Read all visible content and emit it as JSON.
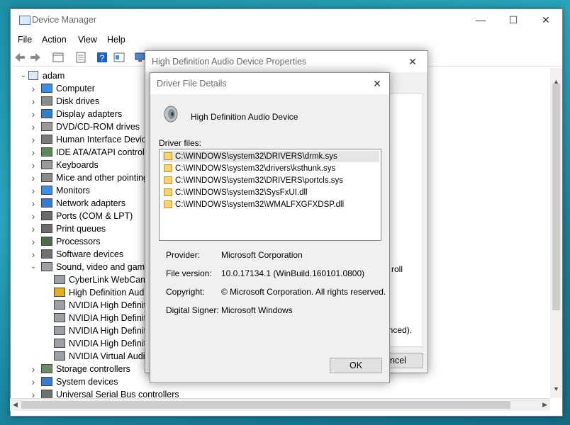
{
  "device_manager": {
    "title": "Device Manager",
    "menu": [
      "File",
      "Action",
      "View",
      "Help"
    ],
    "tree": {
      "root": "adam",
      "items": [
        {
          "label": "Computer",
          "icon": "computer-icon",
          "expanded": false
        },
        {
          "label": "Disk drives",
          "icon": "disk-drive-icon",
          "expanded": false
        },
        {
          "label": "Display adapters",
          "icon": "display-adapter-icon",
          "expanded": false
        },
        {
          "label": "DVD/CD-ROM drives",
          "icon": "dvd-drive-icon",
          "expanded": false
        },
        {
          "label": "Human Interface Device",
          "icon": "hid-icon",
          "expanded": false
        },
        {
          "label": "IDE ATA/ATAPI controlle",
          "icon": "ide-controller-icon",
          "expanded": false
        },
        {
          "label": "Keyboards",
          "icon": "keyboard-icon",
          "expanded": false
        },
        {
          "label": "Mice and other pointing",
          "icon": "mouse-icon",
          "expanded": false
        },
        {
          "label": "Monitors",
          "icon": "monitor-icon",
          "expanded": false
        },
        {
          "label": "Network adapters",
          "icon": "network-adapter-icon",
          "expanded": false
        },
        {
          "label": "Ports (COM & LPT)",
          "icon": "port-icon",
          "expanded": false
        },
        {
          "label": "Print queues",
          "icon": "printer-icon",
          "expanded": false
        },
        {
          "label": "Processors",
          "icon": "processor-icon",
          "expanded": false
        },
        {
          "label": "Software devices",
          "icon": "software-device-icon",
          "expanded": false
        },
        {
          "label": "Sound, video and game",
          "icon": "speaker-icon",
          "expanded": true
        },
        {
          "label": "CyberLink WebCam",
          "icon": "speaker-icon",
          "child": true
        },
        {
          "label": "High Definition Aud",
          "icon": "warning-speaker-icon",
          "child": true
        },
        {
          "label": "NVIDIA High Definiti",
          "icon": "speaker-icon",
          "child": true
        },
        {
          "label": "NVIDIA High Definiti",
          "icon": "speaker-icon",
          "child": true
        },
        {
          "label": "NVIDIA High Definiti",
          "icon": "speaker-icon",
          "child": true
        },
        {
          "label": "NVIDIA High Definiti",
          "icon": "speaker-icon",
          "child": true
        },
        {
          "label": "NVIDIA Virtual Audic",
          "icon": "speaker-icon",
          "child": true
        },
        {
          "label": "Storage controllers",
          "icon": "storage-controller-icon",
          "expanded": false
        },
        {
          "label": "System devices",
          "icon": "system-device-icon",
          "expanded": false
        },
        {
          "label": "Universal Serial Bus controllers",
          "icon": "usb-icon",
          "expanded": false
        }
      ]
    }
  },
  "properties_dialog": {
    "title": "High Definition Audio Device Properties",
    "partial_text_1": "roll",
    "partial_text_2": "anced).",
    "cancel_label_partial": "ncel"
  },
  "driver_dialog": {
    "title": "Driver File Details",
    "device_name": "High Definition Audio Device",
    "driver_files_label": "Driver files:",
    "files": [
      "C:\\WINDOWS\\system32\\DRIVERS\\drmk.sys",
      "C:\\WINDOWS\\system32\\drivers\\ksthunk.sys",
      "C:\\WINDOWS\\system32\\DRIVERS\\portcls.sys",
      "C:\\WINDOWS\\system32\\SysFxUI.dll",
      "C:\\WINDOWS\\system32\\WMALFXGFXDSP.dll"
    ],
    "selected_index": 0,
    "provider_label": "Provider:",
    "provider": "Microsoft Corporation",
    "file_version_label": "File version:",
    "file_version": "10.0.17134.1 (WinBuild.160101.0800)",
    "copyright_label": "Copyright:",
    "copyright": "© Microsoft Corporation. All rights reserved.",
    "signer_label": "Digital Signer:",
    "signer": "Microsoft Windows",
    "ok_label": "OK"
  },
  "colors": {
    "desktop": "#2aa6bb",
    "dialog_bg": "#f0f0f0",
    "selection": "#e5e5e5",
    "accent": "#3a7bd5"
  }
}
